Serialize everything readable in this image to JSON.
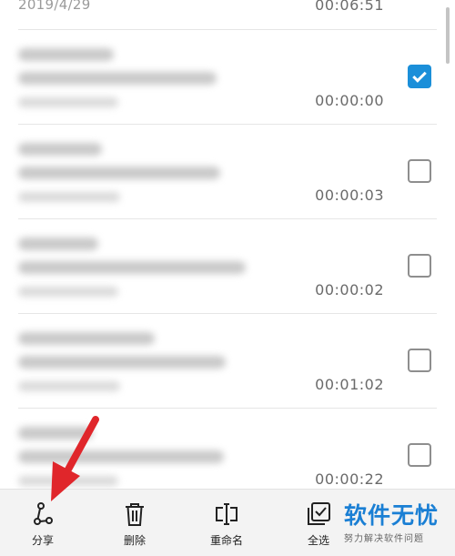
{
  "top_item": {
    "date": "2019/4/29",
    "duration": "00:06:51"
  },
  "recordings": [
    {
      "duration": "00:00:00",
      "checked": true
    },
    {
      "duration": "00:00:03",
      "checked": false
    },
    {
      "duration": "00:00:02",
      "checked": false
    },
    {
      "duration": "00:01:02",
      "checked": false
    },
    {
      "duration": "00:00:22",
      "checked": false
    }
  ],
  "toolbar": {
    "share_label": "分享",
    "delete_label": "删除",
    "rename_label": "重命名",
    "select_all_label": "全选"
  },
  "icons": {
    "share": "share-icon",
    "delete": "trash-icon",
    "rename": "rename-icon",
    "select_all": "select-all-icon",
    "checkbox": "checkbox-icon"
  },
  "watermark": {
    "title": "软件无忧",
    "subtitle": "努力解决软件问题"
  },
  "colors": {
    "accent": "#1b8fd9",
    "watermark": "#1a7fd4",
    "arrow": "#e0262b"
  }
}
